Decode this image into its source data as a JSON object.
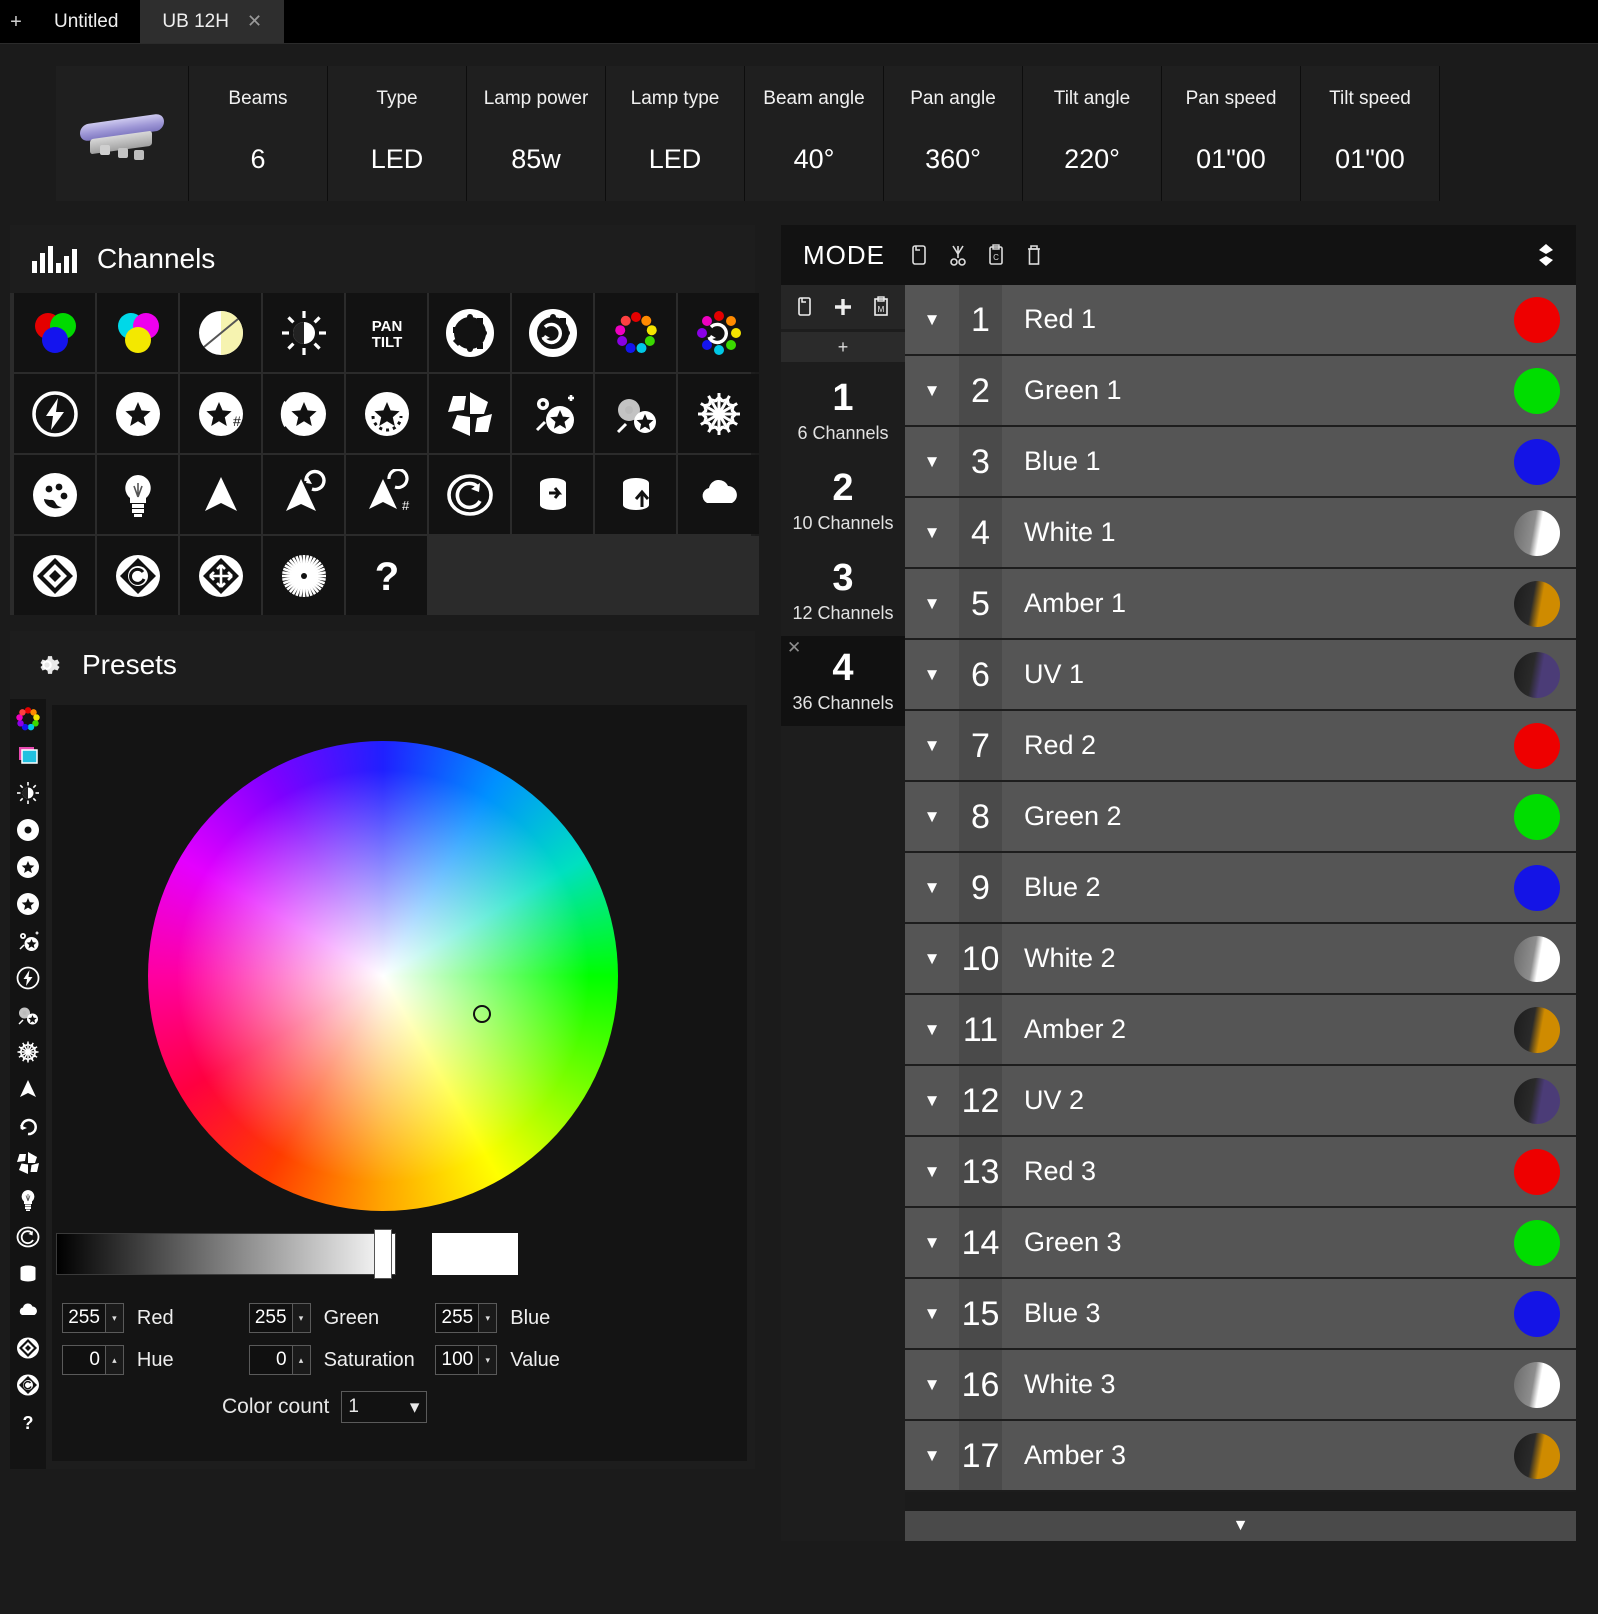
{
  "tabs": [
    {
      "label": "Untitled",
      "active": false,
      "closable": false
    },
    {
      "label": "UB 12H",
      "active": true,
      "closable": true
    }
  ],
  "tab_add_label": "+",
  "tab_close_label": "✕",
  "fixture_stats": [
    {
      "label": "Beams",
      "value": "6"
    },
    {
      "label": "Type",
      "value": "LED"
    },
    {
      "label": "Lamp power",
      "value": "85w"
    },
    {
      "label": "Lamp type",
      "value": "LED"
    },
    {
      "label": "Beam angle",
      "value": "40°"
    },
    {
      "label": "Pan angle",
      "value": "360°"
    },
    {
      "label": "Tilt angle",
      "value": "220°"
    },
    {
      "label": "Pan speed",
      "value": "01\"00"
    },
    {
      "label": "Tilt speed",
      "value": "01\"00"
    }
  ],
  "channels_panel": {
    "title": "Channels",
    "icon": "bar-chart-icon",
    "icons": [
      "rgb-icon",
      "cmy-icon",
      "color-wheel-half-icon",
      "dimmer-icon",
      "pan-tilt-icon",
      "gobo-wheel-icon",
      "gobo-wheel-rotate-icon",
      "color-wheel-icon",
      "color-wheel-rotate-icon",
      "strobe-icon",
      "gobo-star-icon",
      "gobo-star-index-icon",
      "gobo-star-shake-icon",
      "gobo-star-rotate-icon",
      "iris-icon",
      "prism-icon",
      "frost-icon",
      "snowflake-icon",
      "palette-icon",
      "lamp-icon",
      "prism3-icon",
      "prism3-rotate-icon",
      "prism3-index-icon",
      "focus-icon",
      "zoom-in-icon",
      "zoom-out-icon",
      "fog-icon",
      "blade-icon",
      "blade-rotate-icon",
      "blade-move-icon",
      "beam-icon",
      "unknown-icon"
    ]
  },
  "presets_panel": {
    "title": "Presets",
    "icon": "gear-icon",
    "strip_icons": [
      "color-wheel-icon",
      "layers-icon",
      "dimmer-icon",
      "gobo-icon",
      "gobo-star-icon",
      "gobo-rotate-icon",
      "prism-icon",
      "strobe-icon",
      "frost-icon",
      "snowflake-icon",
      "prism3-icon",
      "rotate-icon",
      "iris-icon",
      "lamp-icon",
      "focus-icon",
      "cylinder-icon",
      "fog-icon",
      "blade-icon",
      "blade-rotate-icon",
      "help-icon"
    ],
    "color_picker": {
      "selected_hex": "#ffffff",
      "fields": [
        {
          "name": "Red",
          "value": "255",
          "spin": "▾"
        },
        {
          "name": "Green",
          "value": "255",
          "spin": "▾"
        },
        {
          "name": "Blue",
          "value": "255",
          "spin": "▾"
        },
        {
          "name": "Hue",
          "value": "0",
          "spin": "▴"
        },
        {
          "name": "Saturation",
          "value": "0",
          "spin": "▴"
        },
        {
          "name": "Value",
          "value": "100",
          "spin": "▾"
        }
      ],
      "color_count_label": "Color count",
      "color_count_value": "1"
    }
  },
  "mode_panel": {
    "title": "MODE",
    "toolbar_icons": [
      "copy-icon",
      "cut-icon",
      "paste-icon",
      "trash-icon"
    ],
    "right_icon": "link-icon",
    "column_tools": [
      "copy-icon",
      "add-icon",
      "save-icon"
    ],
    "add_label": "+",
    "modes": [
      {
        "number": "1",
        "channels": "6 Channels",
        "selected": false
      },
      {
        "number": "2",
        "channels": "10 Channels",
        "selected": false
      },
      {
        "number": "3",
        "channels": "12 Channels",
        "selected": false
      },
      {
        "number": "4",
        "channels": "36 Channels",
        "selected": true
      }
    ],
    "mode_close_label": "✕",
    "caret_label": "▼",
    "scroll_down_label": "▼",
    "channels": [
      {
        "number": "1",
        "name": "Red 1",
        "color": "#ee0000",
        "style": "solid"
      },
      {
        "number": "2",
        "name": "Green 1",
        "color": "#00dd00",
        "style": "solid"
      },
      {
        "number": "3",
        "name": "Blue 1",
        "color": "#1414e6",
        "style": "solid"
      },
      {
        "number": "4",
        "name": "White 1",
        "color": "#ffffff",
        "style": "half"
      },
      {
        "number": "5",
        "name": "Amber 1",
        "color": "#cf8b00",
        "style": "half-dark"
      },
      {
        "number": "6",
        "name": "UV 1",
        "color": "#4b3c77",
        "style": "half-dark"
      },
      {
        "number": "7",
        "name": "Red 2",
        "color": "#ee0000",
        "style": "solid"
      },
      {
        "number": "8",
        "name": "Green 2",
        "color": "#00dd00",
        "style": "solid"
      },
      {
        "number": "9",
        "name": "Blue 2",
        "color": "#1414e6",
        "style": "solid"
      },
      {
        "number": "10",
        "name": "White 2",
        "color": "#ffffff",
        "style": "half"
      },
      {
        "number": "11",
        "name": "Amber 2",
        "color": "#cf8b00",
        "style": "half-dark"
      },
      {
        "number": "12",
        "name": "UV 2",
        "color": "#4b3c77",
        "style": "half-dark"
      },
      {
        "number": "13",
        "name": "Red 3",
        "color": "#ee0000",
        "style": "solid"
      },
      {
        "number": "14",
        "name": "Green 3",
        "color": "#00dd00",
        "style": "solid"
      },
      {
        "number": "15",
        "name": "Blue 3",
        "color": "#1414e6",
        "style": "solid"
      },
      {
        "number": "16",
        "name": "White 3",
        "color": "#ffffff",
        "style": "half"
      },
      {
        "number": "17",
        "name": "Amber 3",
        "color": "#cf8b00",
        "style": "half-dark"
      }
    ]
  }
}
